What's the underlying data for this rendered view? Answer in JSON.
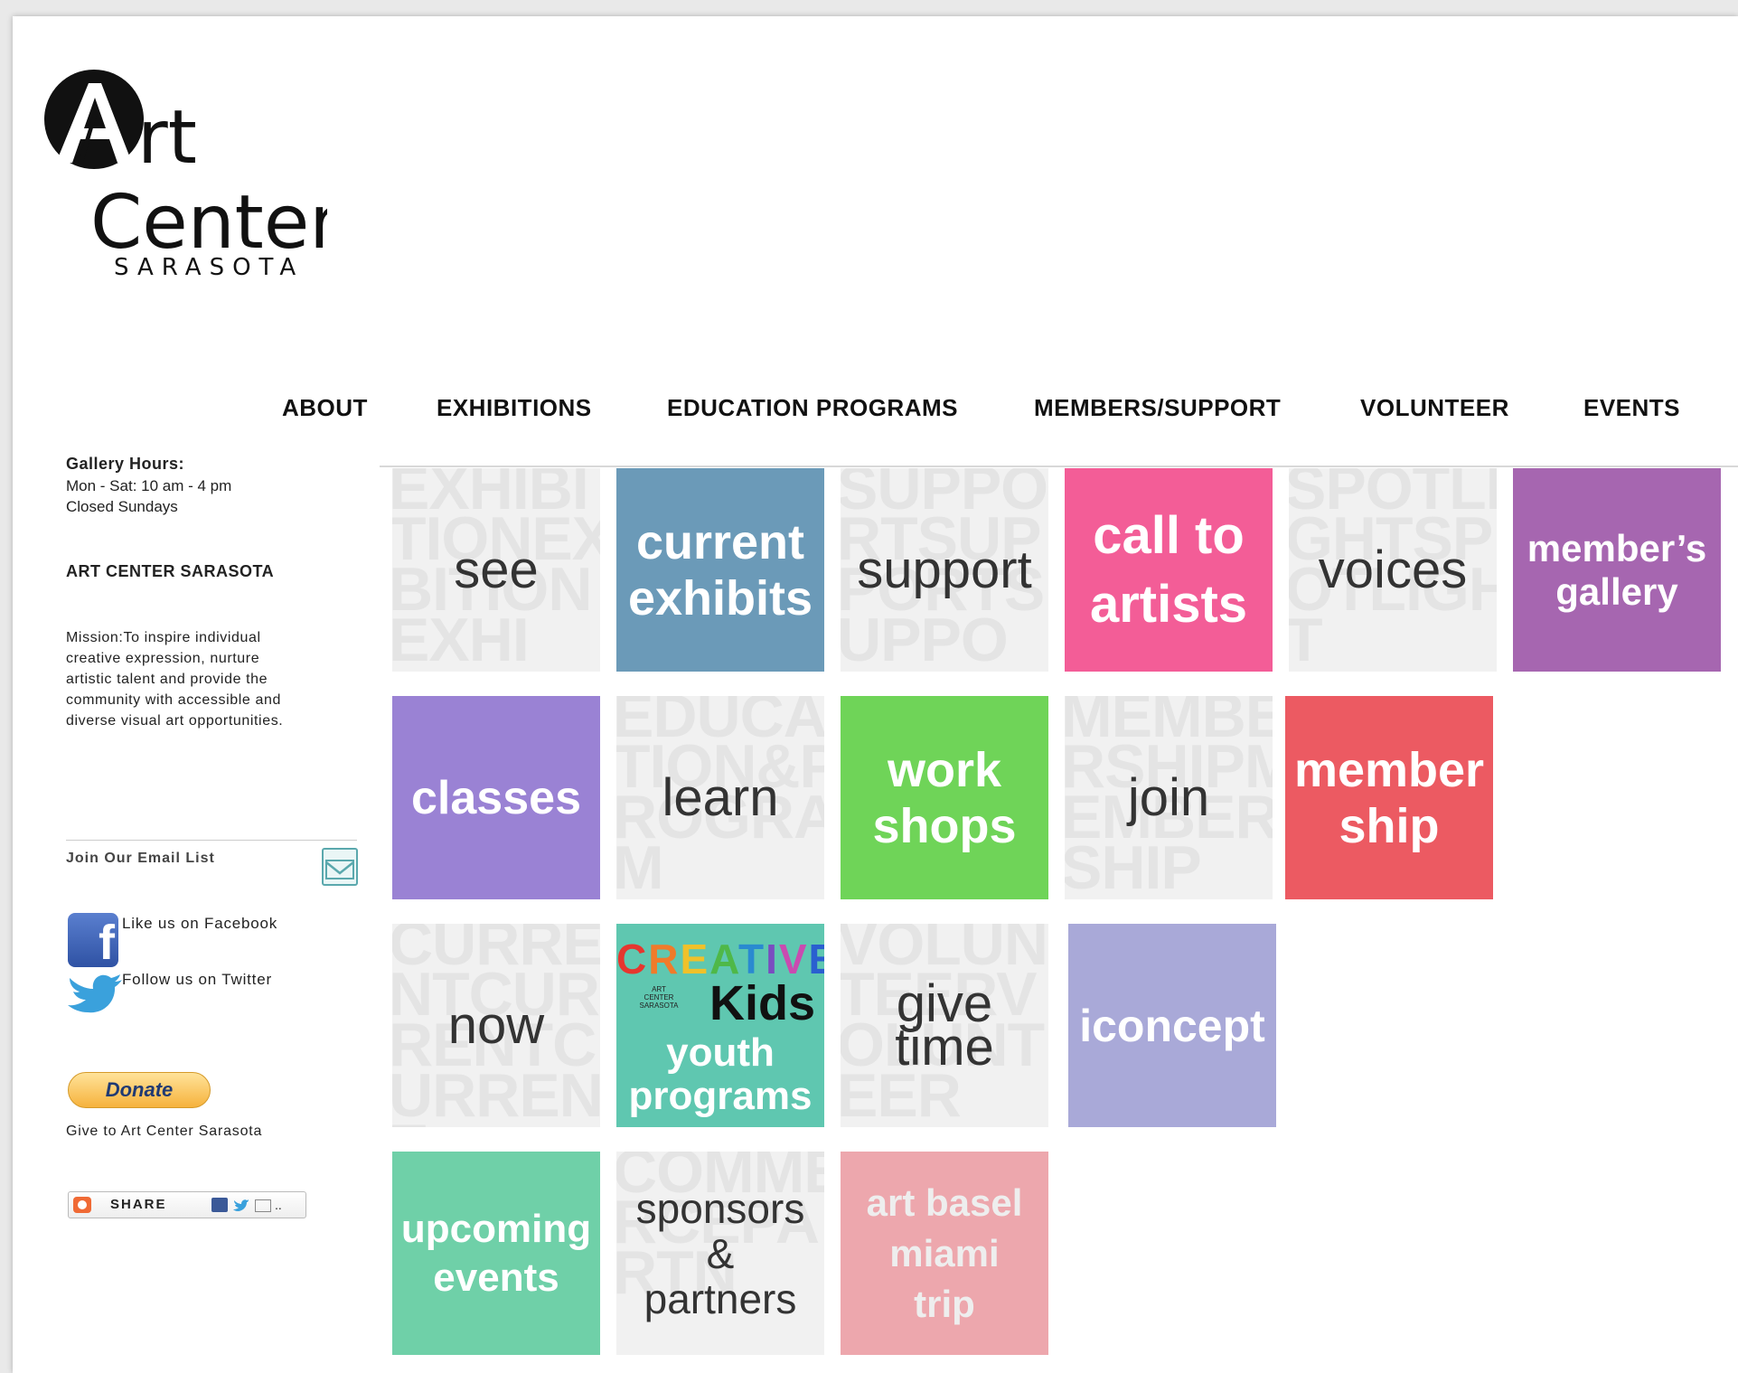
{
  "brand": {
    "logo_word_1": "rt",
    "logo_word_2": "Center",
    "logo_word_3": "SARASOTA",
    "logo_letter": "A"
  },
  "nav": {
    "items": [
      "ABOUT",
      "EXHIBITIONS",
      "EDUCATION PROGRAMS",
      "MEMBERS/SUPPORT",
      "VOLUNTEER",
      "EVENTS"
    ]
  },
  "sidebar": {
    "hours_title": "Gallery Hours:",
    "hours_line_1": "Mon - Sat: 10 am - 4 pm",
    "hours_line_2": "Closed Sundays",
    "org_name": "ART CENTER SARASOTA",
    "mission": "Mission:To inspire individual\ncreative expression, nurture\nartistic talent and provide the\ncommunity with accessible and\ndiverse visual art opportunities.",
    "email_list": "Join Our Email List",
    "facebook": "Like us on Facebook",
    "twitter": "Follow us on Twitter",
    "donate": "Donate",
    "give": "Give to Art Center Sarasota",
    "share": "SHARE"
  },
  "tiles": {
    "see": "see",
    "see_wm": "EXHIBITIONEXBITIONEXHI",
    "current_exhibits": "current\nexhibits",
    "support": "support",
    "support_wm": "SUPPORTSUPPORTSUPPO",
    "call_to_artists": "call to\nartists",
    "voices": "voices",
    "voices_wm": "SPOTLIGHTSPOTLIGHT",
    "members_gallery": "member’s\ngallery",
    "classes": "classes",
    "learn": "learn",
    "learn_wm": "EDUCATION&PROGRAM",
    "workshops": "work\nshops",
    "join": "join",
    "join_wm": "MEMBERSHIPMEMBERSHIP",
    "membership": "member\nship",
    "now": "now",
    "now_wm": "CURRENTCURRENTCURRENT",
    "creative": "CREATIVE",
    "kids": "Kids",
    "kids_small": "ART CENTER SARASOTA",
    "youth_programs": "youth\nprograms",
    "give_time": "give\ntime",
    "give_time_wm": "VOLUNTEERVOLUNTEER",
    "iconcept": "iconcept",
    "upcoming_events": "upcoming\nevents",
    "sponsors": "sponsors\n&\npartners",
    "sponsors_wm": "COMMERCEPARTN",
    "art_basel": "art basel\nmiami\ntrip"
  },
  "colors": {
    "current_exhibits": "#6b9ab8",
    "call_to_artists": "#f35d97",
    "members_gallery": "#a666b0",
    "classes": "#9a82d4",
    "workshops": "#6fd458",
    "membership": "#ec5a62",
    "creative_kids": "#5fc7b0",
    "iconcept": "#a9a9d8",
    "upcoming_events": "#6fd0a8",
    "art_basel": "#eda7ad"
  }
}
